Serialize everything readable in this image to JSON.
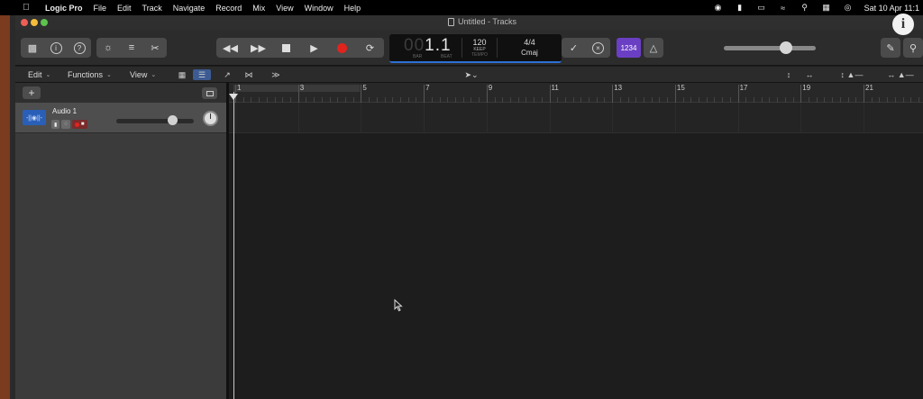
{
  "menubar": {
    "app": "Logic Pro",
    "items": [
      "File",
      "Edit",
      "Track",
      "Navigate",
      "Record",
      "Mix",
      "View",
      "Window",
      "Help"
    ],
    "clock": "Sat 10 Apr 11:1"
  },
  "window": {
    "title": "Untitled - Tracks"
  },
  "lcd": {
    "position_dim": "00",
    "position": "1.1",
    "bar_caption": "BAR",
    "beat_caption": "BEAT",
    "tempo": "120",
    "tempo_mode": "KEEP",
    "tempo_caption": "TEMPO",
    "signature": "4/4",
    "key": "Cmaj"
  },
  "count_in": {
    "label": "1234"
  },
  "subbar": {
    "edit": "Edit",
    "functions": "Functions",
    "view": "View"
  },
  "track": {
    "name": "Audio 1"
  },
  "ruler": {
    "bars": [
      "1",
      "3",
      "5",
      "7",
      "9",
      "11",
      "13",
      "15",
      "17",
      "19",
      "21"
    ]
  },
  "colors": {
    "accent_blue": "#2f6fd6",
    "count_in_purple": "#6b3fc4",
    "record_red": "#e0241d",
    "track_icon_blue": "#2a5fb8"
  }
}
